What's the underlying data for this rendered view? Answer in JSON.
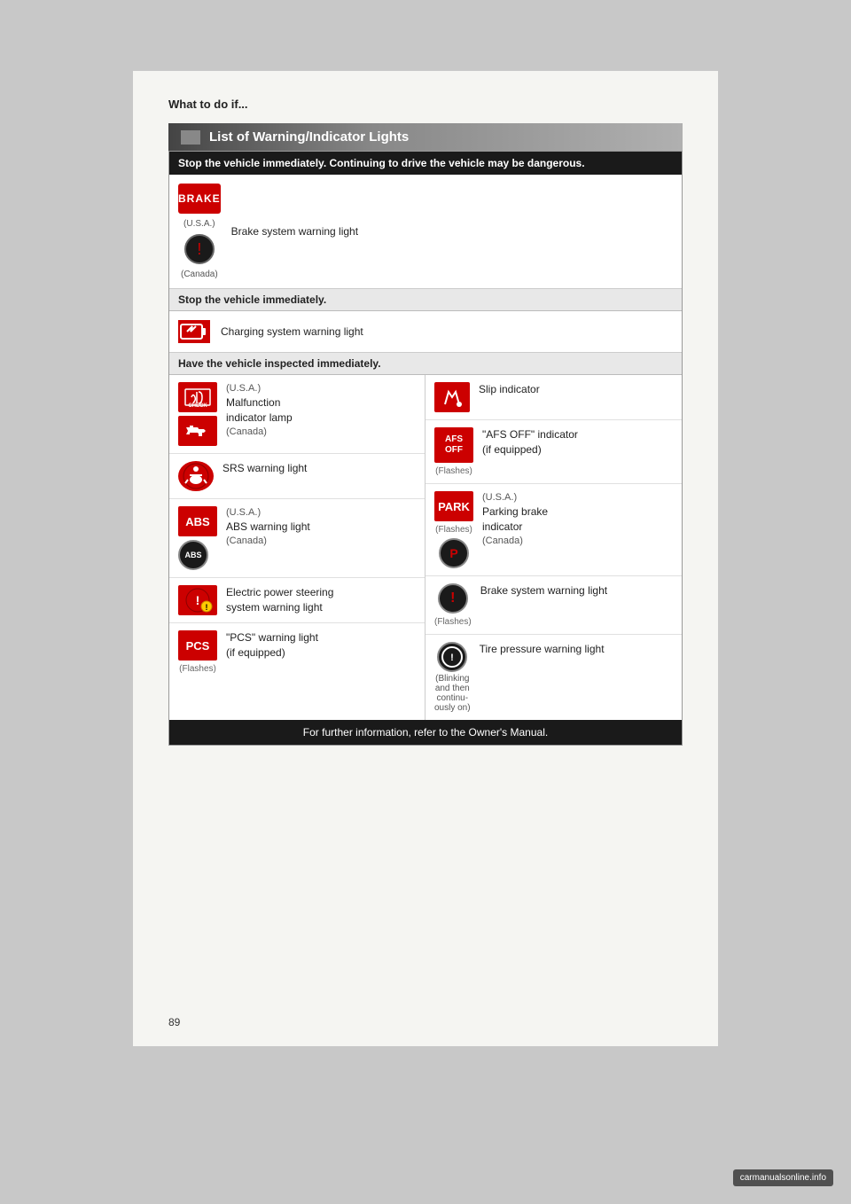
{
  "page": {
    "title": "What to do if...",
    "section_header": "List of Warning/Indicator Lights",
    "page_number": "89"
  },
  "stop_danger": {
    "warning": "Stop the vehicle immediately. Continuing to drive the vehicle may be dangerous."
  },
  "brake_section": {
    "usa_label": "(U.S.A.)",
    "badge": "BRAKE",
    "description": "Brake system warning light",
    "canada_label": "(Canada)"
  },
  "stop_immediately": {
    "warning": "Stop the vehicle immediately."
  },
  "charging_section": {
    "description": "Charging system warning light"
  },
  "inspect_immediately": {
    "warning": "Have the vehicle inspected immediately."
  },
  "left_items": [
    {
      "id": "malfunction",
      "usa_label": "(U.S.A.)",
      "line1": "Malfunction",
      "line2": "indicator lamp",
      "canada_label": "(Canada)"
    },
    {
      "id": "srs",
      "description": "SRS warning light"
    },
    {
      "id": "abs",
      "usa_label": "(U.S.A.)",
      "description": "ABS warning light",
      "canada_label": "(Canada)"
    },
    {
      "id": "eps",
      "line1": "Electric power steering",
      "line2": "system warning light"
    },
    {
      "id": "pcs",
      "badge": "PCS",
      "flashes": "(Flashes)",
      "line1": "\"PCS\" warning light",
      "line2": "(if equipped)"
    }
  ],
  "right_items": [
    {
      "id": "slip",
      "description": "Slip indicator"
    },
    {
      "id": "afs",
      "badge": "AFS OFF",
      "flashes": "(Flashes)",
      "line1": "\"AFS OFF\" indicator",
      "line2": "(if equipped)"
    },
    {
      "id": "park",
      "badge": "PARK",
      "flashes": "(Flashes)",
      "usa_label": "(U.S.A.)",
      "line1": "Parking brake",
      "line2": "indicator",
      "canada_label": "(Canada)"
    },
    {
      "id": "brake_warn",
      "flashes": "(Flashes)",
      "description": "Brake system warning light"
    },
    {
      "id": "tire",
      "note1": "(Blinking",
      "note2": "and then",
      "note3": "continu-",
      "note4": "ously on)",
      "description": "Tire pressure warning light"
    }
  ],
  "footer": {
    "text": "For further information, refer to the Owner's Manual."
  }
}
